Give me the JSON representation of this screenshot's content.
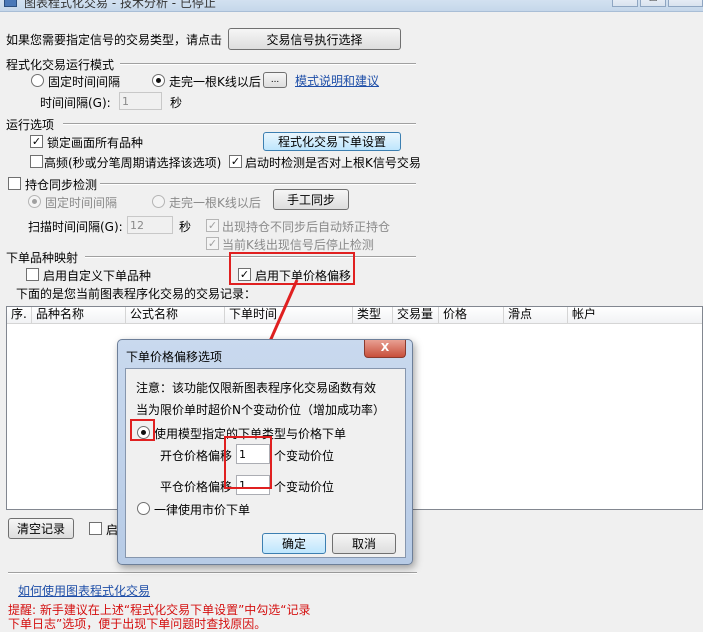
{
  "window": {
    "title": "图表程式化交易 - 技术分析 - 已停止"
  },
  "signal_row": {
    "prompt": "如果您需要指定信号的交易类型，请点击",
    "button": "交易信号执行选择"
  },
  "run_mode": {
    "heading": "程式化交易运行模式",
    "fixed_interval": "固定时间间隔",
    "after_kline": "走完一根K线以后",
    "ellipsis_button": "...",
    "mode_link": "模式说明和建议",
    "interval_label": "时间间隔(G):",
    "interval_value": "1",
    "interval_unit": "秒"
  },
  "run_options": {
    "heading": "运行选项",
    "lock_all": "锁定画面所有品种",
    "order_settings_button": "程式化交易下单设置",
    "high_freq": "高频(秒或分笔周期请选择该选项)",
    "check_on_start": "启动时检测是否对上根K信号交易"
  },
  "position_sync": {
    "label": "持仓同步检测",
    "fixed_interval": "固定时间间隔",
    "after_kline": "走完一根K线以后",
    "manual_sync_button": "手工同步",
    "scan_label": "扫描时间间隔(G):",
    "scan_value": "12",
    "scan_unit": "秒",
    "auto_fix": "出现持仓不同步后自动矫正持仓",
    "stop_on_signal": "当前K线出现信号后停止检测"
  },
  "mapping": {
    "heading": "下单品种映射",
    "custom_symbol": "启用自定义下单品种",
    "price_offset": "启用下单价格偏移",
    "records_caption": "下面的是您当前图表程序化交易的交易记录："
  },
  "table": {
    "columns": [
      "序.",
      "品种名称",
      "公式名称",
      "下单时间",
      "类型",
      "交易量",
      "价格",
      "滑点",
      "帐户"
    ]
  },
  "bottom": {
    "clear_button": "清空记录",
    "cut_checkbox_label": "启",
    "help_link": "如何使用图表程式化交易",
    "tip_line1": "提醒: 新手建议在上述“程式化交易下单设置”中勾选“记录",
    "tip_line2": "下单日志”选项，便于出现下单问题时查找原因。"
  },
  "dialog": {
    "title": "下单价格偏移选项",
    "close": "X",
    "note1": "注意：该功能仅限新图表程序化交易函数有效",
    "note2": "当为限价单时超价N个变动价位（增加成功率）",
    "use_model": "使用模型指定的下单类型与价格下单",
    "open_label": "开仓价格偏移",
    "open_value": "1",
    "open_unit": "个变动价位",
    "close_label": "平仓价格偏移",
    "close_value": "1",
    "close_unit": "个变动价位",
    "market": "一律使用市价下单",
    "ok": "确定",
    "cancel": "取消"
  },
  "colors": {
    "highlight": "#e02020",
    "link": "#1f4fa8",
    "tip": "#d41010"
  }
}
